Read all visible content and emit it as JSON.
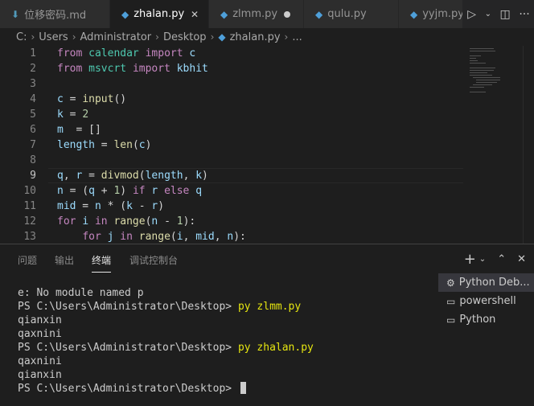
{
  "tabs": [
    {
      "label": "位移密码.md",
      "icon": "markdown-icon",
      "active": false
    },
    {
      "label": "zhalan.py",
      "icon": "python-icon",
      "active": true
    },
    {
      "label": "zlmm.py",
      "icon": "python-icon",
      "active": false,
      "dirty": true
    },
    {
      "label": "qulu.py",
      "icon": "python-icon",
      "active": false
    },
    {
      "label": "yyjm.py",
      "icon": "python-icon",
      "active": false
    }
  ],
  "tab_actions": [
    "run-icon",
    "split-editor-icon",
    "more-icon"
  ],
  "breadcrumb": [
    "C:",
    "Users",
    "Administrator",
    "Desktop",
    "zhalan.py",
    "..."
  ],
  "editor": {
    "current_line": 9,
    "lines": [
      {
        "n": "1",
        "text": "from calendar import c"
      },
      {
        "n": "2",
        "text": "from msvcrt import kbhit"
      },
      {
        "n": "3",
        "text": ""
      },
      {
        "n": "4",
        "text": "c = input()"
      },
      {
        "n": "5",
        "text": "k = 2"
      },
      {
        "n": "6",
        "text": "m  = []"
      },
      {
        "n": "7",
        "text": "length = len(c)"
      },
      {
        "n": "8",
        "text": ""
      },
      {
        "n": "9",
        "text": "q, r = divmod(length, k)"
      },
      {
        "n": "10",
        "text": "n = (q + 1) if r else q"
      },
      {
        "n": "11",
        "text": "mid = n * (k - r)"
      },
      {
        "n": "12",
        "text": "for i in range(n - 1):"
      },
      {
        "n": "13",
        "text": "    for j in range(i, mid, n):"
      }
    ]
  },
  "panel": {
    "tabs": [
      "问题",
      "输出",
      "终端",
      "调试控制台"
    ],
    "active_tab": "终端",
    "terminal_lines": [
      {
        "prompt": "e: No module named p",
        "cmd": ""
      },
      {
        "prompt": "PS C:\\Users\\Administrator\\Desktop> ",
        "cmd": "py zlmm.py"
      },
      {
        "prompt": "qianxin",
        "cmd": ""
      },
      {
        "prompt": "qaxnini",
        "cmd": ""
      },
      {
        "prompt": "PS C:\\Users\\Administrator\\Desktop> ",
        "cmd": "py zhalan.py"
      },
      {
        "prompt": "qaxnini",
        "cmd": ""
      },
      {
        "prompt": "qianxin",
        "cmd": ""
      },
      {
        "prompt": "PS C:\\Users\\Administrator\\Desktop> ",
        "cmd": ""
      }
    ],
    "terminals": [
      {
        "label": "Python Deb...",
        "icon": "debug-icon",
        "active": true
      },
      {
        "label": "powershell",
        "icon": "terminal-icon",
        "active": false
      },
      {
        "label": "Python",
        "icon": "terminal-icon",
        "active": false
      }
    ]
  },
  "colors": {
    "background": "#1e1e1e",
    "keyword": "#c586c0",
    "function": "#dcdcaa",
    "number": "#b5cea8",
    "command": "#e5e510"
  }
}
